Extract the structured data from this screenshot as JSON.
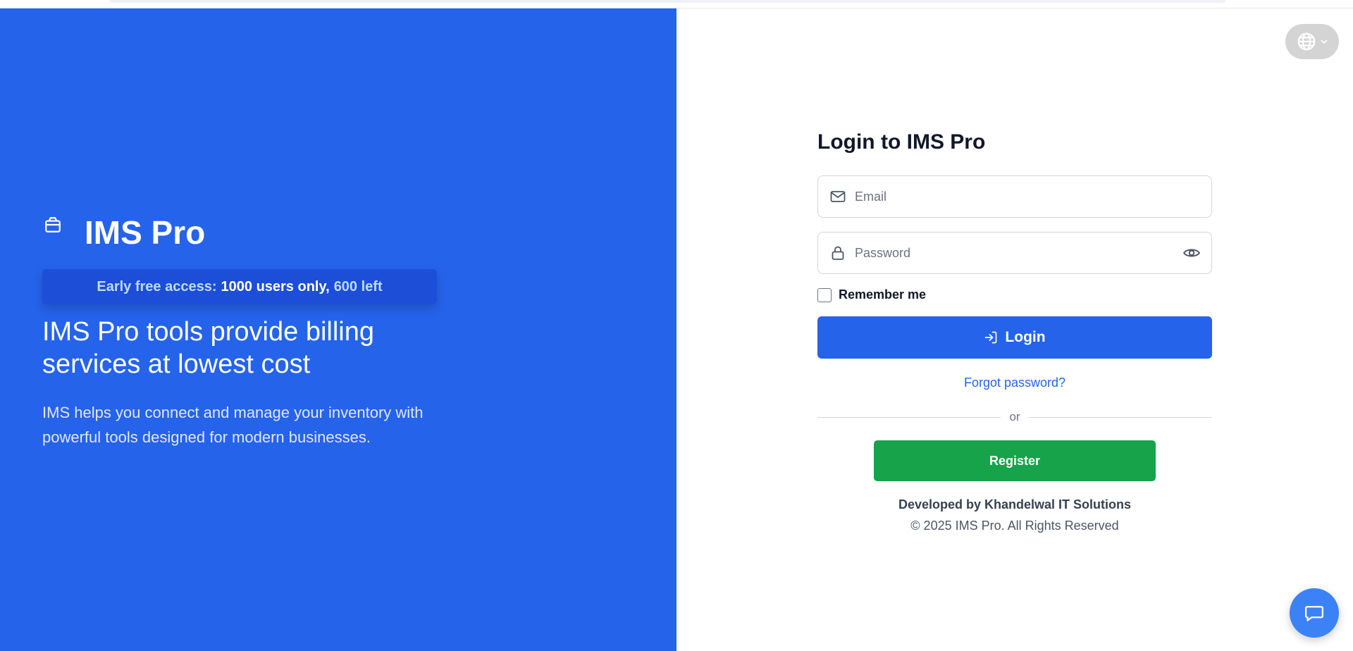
{
  "brand": {
    "title": "IMS Pro",
    "icon": "package-icon"
  },
  "banner": {
    "prefix": "Early free access: ",
    "highlight": "1000 users only,",
    "remaining": " 600 left"
  },
  "hero": {
    "headline": "IMS Pro tools provide billing services at lowest cost",
    "tagline": "IMS helps you connect and manage your inventory with powerful tools designed for modern businesses."
  },
  "language": {
    "icon": "globe-icon"
  },
  "login": {
    "title": "Login to IMS Pro",
    "email_placeholder": "Email",
    "password_placeholder": "Password",
    "remember_label": "Remember me",
    "login_label": "Login",
    "forgot_label": "Forgot password?",
    "or_label": "or",
    "register_label": "Register"
  },
  "footer": {
    "developed_by": "Developed by Khandelwal IT Solutions",
    "copyright": "© 2025 IMS Pro. All Rights Reserved"
  },
  "colors": {
    "primary": "#2563eb",
    "success": "#16a34a",
    "chat": "#3b82f6"
  }
}
